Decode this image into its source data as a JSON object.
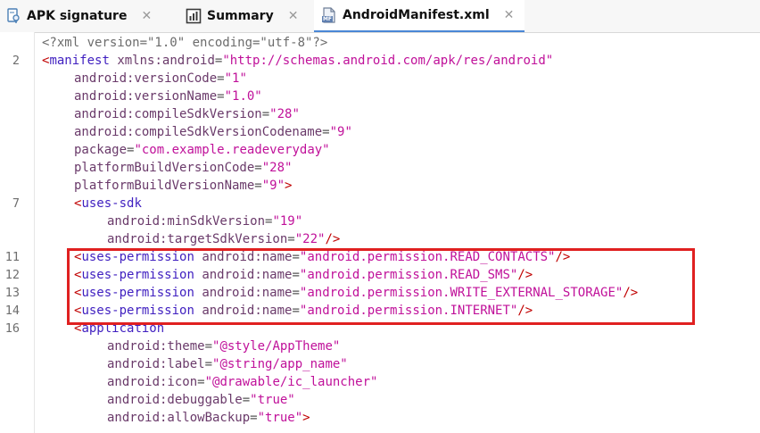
{
  "tabs": [
    {
      "label": "APK signature",
      "icon": "apk-signature-icon",
      "active": false
    },
    {
      "label": "Summary",
      "icon": "summary-chart-icon",
      "active": false
    },
    {
      "label": "AndroidManifest.xml",
      "icon": "manifest-file-icon",
      "active": true
    }
  ],
  "tab_close_glyph": "✕",
  "manifest_badge": "MF",
  "lines": [
    {
      "num": "",
      "indent": 0,
      "parts": [
        [
          "decl",
          "<?xml version=\"1.0\" encoding=\"utf-8\"?>"
        ]
      ]
    },
    {
      "num": "2",
      "indent": 0,
      "parts": [
        [
          "br",
          "<"
        ],
        [
          "tag",
          "manifest"
        ],
        [
          "sp",
          " "
        ],
        [
          "attr",
          "xmlns:android"
        ],
        [
          "eq",
          "="
        ],
        [
          "val",
          "\"http://schemas.android.com/apk/res/android\""
        ]
      ]
    },
    {
      "num": "",
      "indent": 1,
      "parts": [
        [
          "attr",
          "android:versionCode"
        ],
        [
          "eq",
          "="
        ],
        [
          "val",
          "\"1\""
        ]
      ]
    },
    {
      "num": "",
      "indent": 1,
      "parts": [
        [
          "attr",
          "android:versionName"
        ],
        [
          "eq",
          "="
        ],
        [
          "val",
          "\"1.0\""
        ]
      ]
    },
    {
      "num": "",
      "indent": 1,
      "parts": [
        [
          "attr",
          "android:compileSdkVersion"
        ],
        [
          "eq",
          "="
        ],
        [
          "val",
          "\"28\""
        ]
      ]
    },
    {
      "num": "",
      "indent": 1,
      "parts": [
        [
          "attr",
          "android:compileSdkVersionCodename"
        ],
        [
          "eq",
          "="
        ],
        [
          "val",
          "\"9\""
        ]
      ]
    },
    {
      "num": "",
      "indent": 1,
      "parts": [
        [
          "attr",
          "package"
        ],
        [
          "eq",
          "="
        ],
        [
          "val",
          "\"com.example.readeveryday\""
        ]
      ]
    },
    {
      "num": "",
      "indent": 1,
      "parts": [
        [
          "attr",
          "platformBuildVersionCode"
        ],
        [
          "eq",
          "="
        ],
        [
          "val",
          "\"28\""
        ]
      ]
    },
    {
      "num": "",
      "indent": 1,
      "parts": [
        [
          "attr",
          "platformBuildVersionName"
        ],
        [
          "eq",
          "="
        ],
        [
          "val",
          "\"9\""
        ],
        [
          "br",
          ">"
        ]
      ]
    },
    {
      "num": "7",
      "indent": 1,
      "parts": [
        [
          "br",
          "<"
        ],
        [
          "tag",
          "uses-sdk"
        ]
      ]
    },
    {
      "num": "",
      "indent": 2,
      "parts": [
        [
          "attr",
          "android:minSdkVersion"
        ],
        [
          "eq",
          "="
        ],
        [
          "val",
          "\"19\""
        ]
      ]
    },
    {
      "num": "",
      "indent": 2,
      "parts": [
        [
          "attr",
          "android:targetSdkVersion"
        ],
        [
          "eq",
          "="
        ],
        [
          "val",
          "\"22\""
        ],
        [
          "br",
          "/>"
        ]
      ]
    },
    {
      "num": "11",
      "indent": 1,
      "parts": [
        [
          "br",
          "<"
        ],
        [
          "tag",
          "uses-permission"
        ],
        [
          "sp",
          " "
        ],
        [
          "attr",
          "android:name"
        ],
        [
          "eq",
          "="
        ],
        [
          "val",
          "\"android.permission.READ_CONTACTS\""
        ],
        [
          "br",
          "/>"
        ]
      ]
    },
    {
      "num": "12",
      "indent": 1,
      "parts": [
        [
          "br",
          "<"
        ],
        [
          "tag",
          "uses-permission"
        ],
        [
          "sp",
          " "
        ],
        [
          "attr",
          "android:name"
        ],
        [
          "eq",
          "="
        ],
        [
          "val",
          "\"android.permission.READ_SMS\""
        ],
        [
          "br",
          "/>"
        ]
      ]
    },
    {
      "num": "13",
      "indent": 1,
      "parts": [
        [
          "br",
          "<"
        ],
        [
          "tag",
          "uses-permission"
        ],
        [
          "sp",
          " "
        ],
        [
          "attr",
          "android:name"
        ],
        [
          "eq",
          "="
        ],
        [
          "val",
          "\"android.permission.WRITE_EXTERNAL_STORAGE\""
        ],
        [
          "br",
          "/>"
        ]
      ]
    },
    {
      "num": "14",
      "indent": 1,
      "parts": [
        [
          "br",
          "<"
        ],
        [
          "tag",
          "uses-permission"
        ],
        [
          "sp",
          " "
        ],
        [
          "attr",
          "android:name"
        ],
        [
          "eq",
          "="
        ],
        [
          "val",
          "\"android.permission.INTERNET\""
        ],
        [
          "br",
          "/>"
        ]
      ]
    },
    {
      "num": "16",
      "indent": 1,
      "parts": [
        [
          "br",
          "<"
        ],
        [
          "tag",
          "application"
        ]
      ]
    },
    {
      "num": "",
      "indent": 2,
      "parts": [
        [
          "attr",
          "android:theme"
        ],
        [
          "eq",
          "="
        ],
        [
          "val",
          "\"@style/AppTheme\""
        ]
      ]
    },
    {
      "num": "",
      "indent": 2,
      "parts": [
        [
          "attr",
          "android:label"
        ],
        [
          "eq",
          "="
        ],
        [
          "val",
          "\"@string/app_name\""
        ]
      ]
    },
    {
      "num": "",
      "indent": 2,
      "parts": [
        [
          "attr",
          "android:icon"
        ],
        [
          "eq",
          "="
        ],
        [
          "val",
          "\"@drawable/ic_launcher\""
        ]
      ]
    },
    {
      "num": "",
      "indent": 2,
      "parts": [
        [
          "attr",
          "android:debuggable"
        ],
        [
          "eq",
          "="
        ],
        [
          "val",
          "\"true\""
        ]
      ]
    },
    {
      "num": "",
      "indent": 2,
      "parts": [
        [
          "attr",
          "android:allowBackup"
        ],
        [
          "eq",
          "="
        ],
        [
          "val",
          "\"true\""
        ],
        [
          "br",
          ">"
        ]
      ]
    }
  ],
  "colors": {
    "highlight_box": "#e02020",
    "tag": "#3f1fc0",
    "bracket": "#c00000",
    "attribute": "#6a3a6a",
    "value": "#c0119a",
    "active_tab_underline": "#4a87d6"
  }
}
